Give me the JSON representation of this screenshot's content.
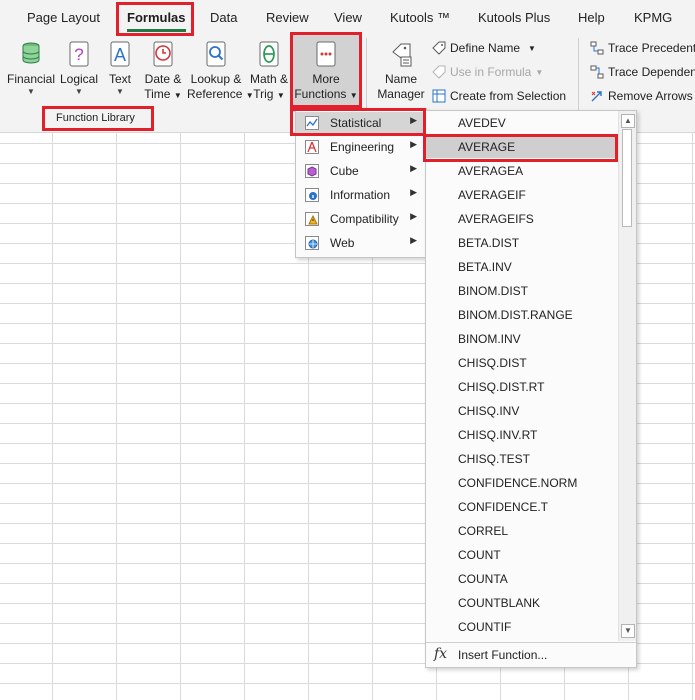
{
  "tabs": [
    {
      "label": "Page Layout"
    },
    {
      "label": "Formulas"
    },
    {
      "label": "Data"
    },
    {
      "label": "Review"
    },
    {
      "label": "View"
    },
    {
      "label": "Kutools ™"
    },
    {
      "label": "Kutools Plus"
    },
    {
      "label": "Help"
    },
    {
      "label": "KPMG"
    }
  ],
  "active_tab": "Formulas",
  "ribbon": {
    "function_library": {
      "group_label": "Function Library",
      "buttons": [
        {
          "line1": "Financial",
          "line2": "",
          "icon": "financial-icon"
        },
        {
          "line1": "Logical",
          "line2": "",
          "icon": "logical-icon"
        },
        {
          "line1": "Text",
          "line2": "",
          "icon": "text-icon"
        },
        {
          "line1": "Date &",
          "line2": "Time",
          "icon": "date-time-icon"
        },
        {
          "line1": "Lookup &",
          "line2": "Reference",
          "icon": "lookup-reference-icon"
        },
        {
          "line1": "Math &",
          "line2": "Trig",
          "icon": "math-trig-icon"
        },
        {
          "line1": "More",
          "line2": "Functions",
          "icon": "more-functions-icon"
        }
      ]
    },
    "defined_names": {
      "name_manager": {
        "line1": "Name",
        "line2": "Manager"
      },
      "define_name": "Define Name",
      "use_in_formula": "Use in Formula",
      "create_from_selection": "Create from Selection"
    },
    "formula_auditing": {
      "trace_precedents": "Trace Precedents",
      "trace_dependents": "Trace Dependents",
      "remove_arrows": "Remove Arrows"
    }
  },
  "more_functions_menu": {
    "categories": [
      {
        "label": "Statistical",
        "icon": "statistical-icon"
      },
      {
        "label": "Engineering",
        "icon": "engineering-icon"
      },
      {
        "label": "Cube",
        "icon": "cube-icon"
      },
      {
        "label": "Information",
        "icon": "information-icon"
      },
      {
        "label": "Compatibility",
        "icon": "compatibility-icon"
      },
      {
        "label": "Web",
        "icon": "web-icon"
      }
    ],
    "selected_category": "Statistical"
  },
  "statistical_menu": {
    "functions": [
      "AVEDEV",
      "AVERAGE",
      "AVERAGEA",
      "AVERAGEIF",
      "AVERAGEIFS",
      "BETA.DIST",
      "BETA.INV",
      "BINOM.DIST",
      "BINOM.DIST.RANGE",
      "BINOM.INV",
      "CHISQ.DIST",
      "CHISQ.DIST.RT",
      "CHISQ.INV",
      "CHISQ.INV.RT",
      "CHISQ.TEST",
      "CONFIDENCE.NORM",
      "CONFIDENCE.T",
      "CORREL",
      "COUNT",
      "COUNTA",
      "COUNTBLANK",
      "COUNTIF"
    ],
    "selected_function": "AVERAGE",
    "footer_icon": "fx",
    "footer_label": "Insert Function..."
  }
}
